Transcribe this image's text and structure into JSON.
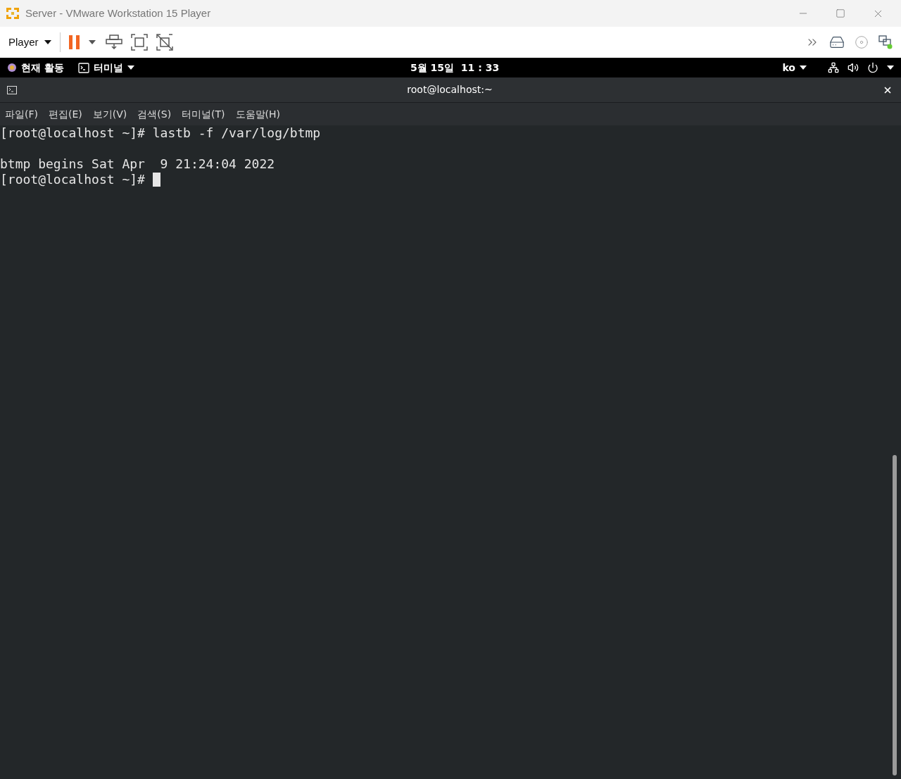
{
  "window": {
    "title": "Server - VMware Workstation 15 Player"
  },
  "toolbar": {
    "menu": "Player"
  },
  "top_bar": {
    "activities": "현재 활동",
    "app_menu": "터미널",
    "clock": "5월 15일  11 : 33",
    "input_method": "ko"
  },
  "terminal": {
    "title": "root@localhost:~",
    "menu": [
      "파일(F)",
      "편집(E)",
      "보기(V)",
      "검색(S)",
      "터미널(T)",
      "도움말(H)"
    ],
    "lines": [
      {
        "kind": "text",
        "text": "[root@localhost ~]# lastb -f /var/log/btmp",
        "cursor": false
      },
      {
        "kind": "blank",
        "cursor": false
      },
      {
        "kind": "text",
        "text": "btmp begins Sat Apr  9 21:24:04 2022",
        "cursor": false
      },
      {
        "kind": "text",
        "text": "[root@localhost ~]# ",
        "cursor": true
      }
    ]
  }
}
